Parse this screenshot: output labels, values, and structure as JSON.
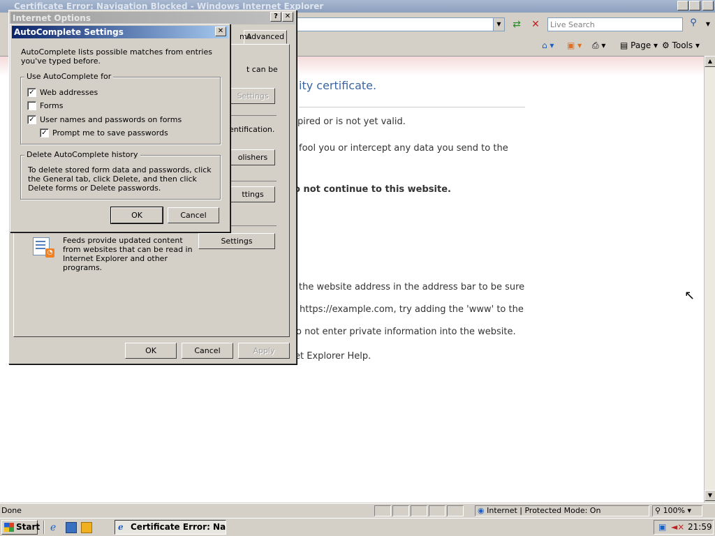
{
  "ie": {
    "title": "Certificate Error: Navigation Blocked - Windows Internet Explorer",
    "search_placeholder": "Live Search",
    "cmd_page": "Page",
    "cmd_tools": "Tools",
    "content": {
      "heading_fragment": "ity certificate.",
      "line1": "pired or is not yet valid.",
      "line2": "fool you or intercept any data you send to the",
      "line3": "o not continue to this website.",
      "line4": "the website address in the address bar to be sure",
      "line5": "https://example.com, try adding the 'www' to the",
      "line6": "o not enter private information into the website.",
      "line7": "et Explorer Help."
    },
    "status": {
      "left": "Done",
      "zone": "Internet | Protected Mode: On",
      "zoom": "100%"
    }
  },
  "taskbar": {
    "start": "Start",
    "task": "Certificate Error: Navi...",
    "clock": "21:59"
  },
  "internet_options": {
    "title": "Internet Options",
    "tab_fragment": "ms",
    "tab_advanced": "Advanced",
    "frag_can_be": "t can be",
    "frag_settings_disabled": "Settings",
    "frag_ident": "entification.",
    "frag_publishers": "olishers",
    "frag_settings2": "ttings",
    "feeds_text": "Feeds provide updated content from websites that can be read in Internet Explorer and other programs.",
    "feeds_settings": "Settings",
    "ok": "OK",
    "cancel": "Cancel",
    "apply": "Apply"
  },
  "autocomplete": {
    "title": "AutoComplete Settings",
    "intro": "AutoComplete lists possible matches from entries you've typed before.",
    "use_group": "Use AutoComplete for",
    "options": [
      {
        "label": "Web addresses",
        "checked": true
      },
      {
        "label": "Forms",
        "checked": false
      },
      {
        "label": "User names and passwords on forms",
        "checked": true
      },
      {
        "label": "Prompt me to save passwords",
        "checked": true
      }
    ],
    "history_group": "Delete AutoComplete history",
    "history_text": "To delete stored form data and passwords, click the General tab, click Delete, and then click Delete forms or Delete passwords.",
    "ok": "OK",
    "cancel": "Cancel"
  }
}
